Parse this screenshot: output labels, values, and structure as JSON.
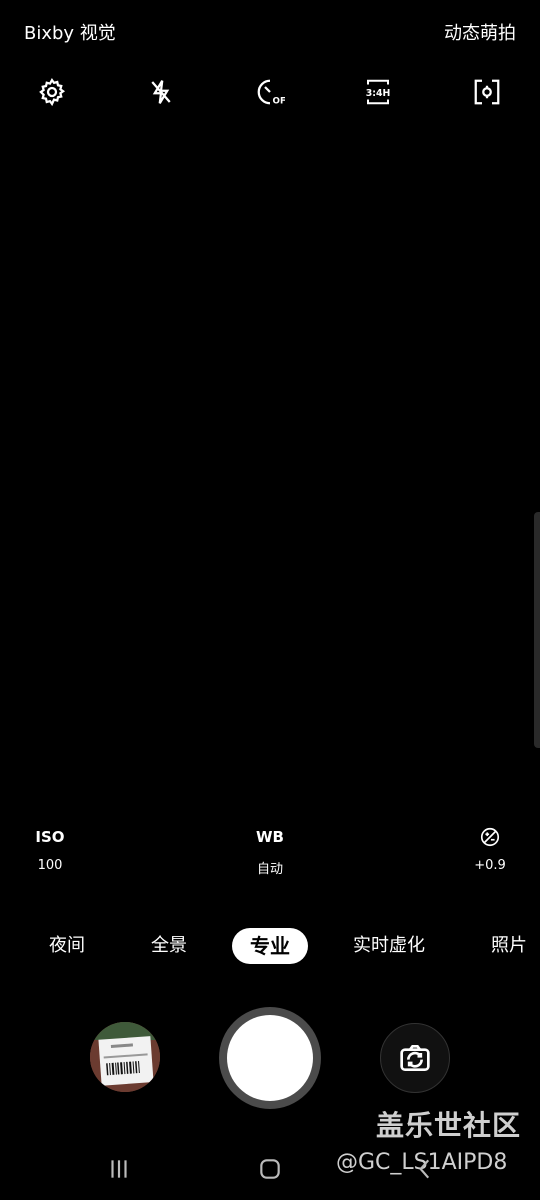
{
  "top": {
    "left_label": "Bixby 视觉",
    "right_label": "动态萌拍"
  },
  "toolbar": {
    "icons": [
      "gear-icon",
      "flash-off-icon",
      "timer-off-icon",
      "aspect-ratio-3-4-icon",
      "focus-mode-icon"
    ],
    "ratio_text": "3:4H",
    "timer_text": "OFF"
  },
  "pro": {
    "iso_label": "ISO",
    "iso_value": "100",
    "wb_label": "WB",
    "wb_value": "自动",
    "ev_value": "+0.9"
  },
  "modes": [
    "夜间",
    "全景",
    "专业",
    "实时虚化",
    "照片"
  ],
  "active_mode": "专业",
  "watermark": {
    "line1": "盖乐世社区",
    "line2": "@GC_LS1AIPD8"
  },
  "colors": {
    "background": "#000000",
    "active_pill": "#ffffff",
    "shutter_ring": "#4b4b4b"
  }
}
